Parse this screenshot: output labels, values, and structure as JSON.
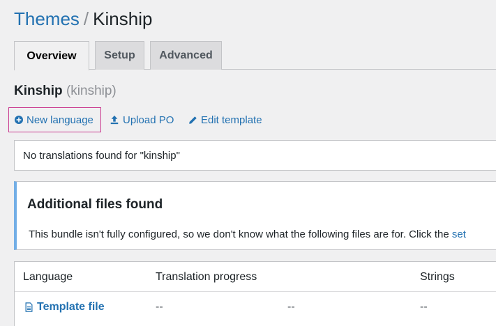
{
  "breadcrumb": {
    "parent": "Themes",
    "separator": "/",
    "current": "Kinship"
  },
  "tabs": [
    {
      "label": "Overview",
      "active": true
    },
    {
      "label": "Setup",
      "active": false
    },
    {
      "label": "Advanced",
      "active": false
    }
  ],
  "bundle": {
    "name": "Kinship",
    "slug": "(kinship)"
  },
  "actions": {
    "new_language": "New language",
    "upload_po": "Upload PO",
    "edit_template": "Edit template"
  },
  "notice": {
    "text": "No translations found for \"kinship\""
  },
  "additional_files": {
    "title": "Additional files found",
    "text": "This bundle isn't fully configured, so we don't know what the following files are for. Click the ",
    "link": "set"
  },
  "table": {
    "columns": [
      "Language",
      "Translation progress",
      "Strings"
    ],
    "rows": [
      {
        "language": "Template file",
        "progress": "--",
        "progress_pct": "--",
        "strings": "--"
      }
    ]
  },
  "colors": {
    "link": "#2271b1",
    "focus_outline": "#c9388e",
    "info_border": "#72aee6",
    "background": "#f0f0f1"
  }
}
